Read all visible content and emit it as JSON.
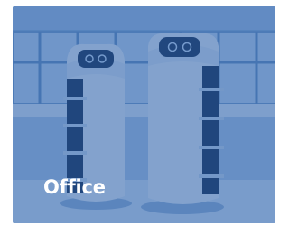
{
  "card": {
    "label": "Office",
    "label_color": "#ffffff",
    "tint_color": "#265ca8"
  },
  "scene": {
    "description_icon": "service-robots-image",
    "robots": [
      "robot-left",
      "robot-right"
    ]
  }
}
